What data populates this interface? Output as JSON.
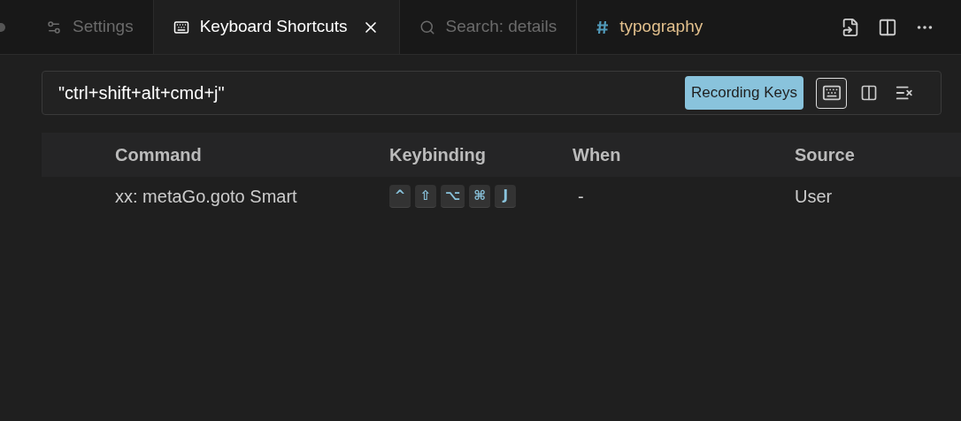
{
  "tabs": [
    {
      "kind": "settings",
      "label": "Settings",
      "selected": false
    },
    {
      "kind": "keyboard",
      "label": "Keyboard Shortcuts",
      "selected": true
    },
    {
      "kind": "search",
      "label": "Search: details",
      "selected": false
    },
    {
      "kind": "hash",
      "label": "typography",
      "selected": false
    }
  ],
  "search": {
    "value": "\"ctrl+shift+alt+cmd+j\"",
    "badge": "Recording Keys",
    "record_keys_toggle": {
      "checked": true
    }
  },
  "table": {
    "columns": [
      "Command",
      "Keybinding",
      "When",
      "Source"
    ],
    "rows": [
      {
        "command": "xx: metaGo.goto Smart",
        "keys": [
          "^",
          "⇧",
          "⌥",
          "⌘",
          "J"
        ],
        "when": "-",
        "source": "User"
      }
    ]
  }
}
